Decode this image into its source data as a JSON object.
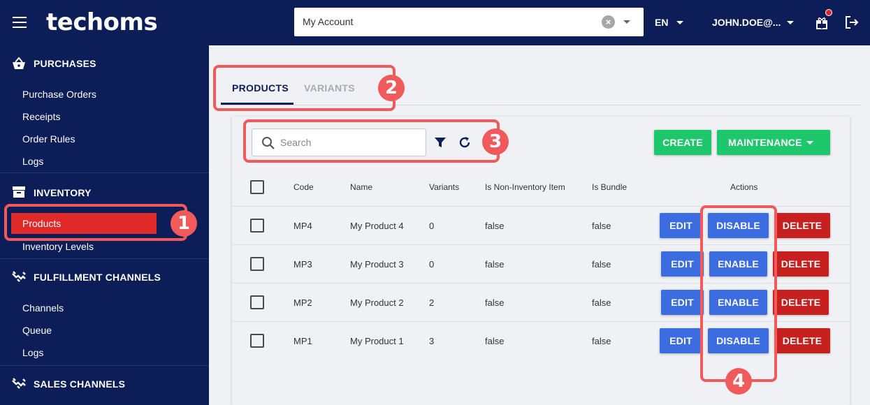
{
  "header": {
    "logo": "techoms",
    "account_value": "My Account",
    "language": "EN",
    "user": "JOHN.DOE@..."
  },
  "sidebar": {
    "sections": [
      {
        "title": "PURCHASES",
        "items": [
          "Purchase Orders",
          "Receipts",
          "Order Rules",
          "Logs"
        ]
      },
      {
        "title": "INVENTORY",
        "items": [
          "Products",
          "Inventory Levels"
        ]
      },
      {
        "title": "FULFILLMENT CHANNELS",
        "items": [
          "Channels",
          "Queue",
          "Logs"
        ]
      },
      {
        "title": "SALES CHANNELS",
        "items": []
      }
    ],
    "active_item": "Products"
  },
  "tabs": [
    {
      "label": "PRODUCTS",
      "active": true
    },
    {
      "label": "VARIANTS",
      "active": false
    }
  ],
  "toolbar": {
    "search_placeholder": "Search",
    "create_label": "CREATE",
    "maintenance_label": "MAINTENANCE"
  },
  "table": {
    "headers": [
      "Code",
      "Name",
      "Variants",
      "Is Non-Inventory Item",
      "Is Bundle",
      "Actions"
    ],
    "rows": [
      {
        "code": "MP4",
        "name": "My Product 4",
        "variants": "0",
        "non_inventory": "false",
        "bundle": "false",
        "edit": "EDIT",
        "toggle": "DISABLE",
        "delete": "DELETE"
      },
      {
        "code": "MP3",
        "name": "My Product 3",
        "variants": "0",
        "non_inventory": "false",
        "bundle": "false",
        "edit": "EDIT",
        "toggle": "ENABLE",
        "delete": "DELETE"
      },
      {
        "code": "MP2",
        "name": "My Product 2",
        "variants": "2",
        "non_inventory": "false",
        "bundle": "false",
        "edit": "EDIT",
        "toggle": "ENABLE",
        "delete": "DELETE"
      },
      {
        "code": "MP1",
        "name": "My Product 1",
        "variants": "3",
        "non_inventory": "false",
        "bundle": "false",
        "edit": "EDIT",
        "toggle": "DISABLE",
        "delete": "DELETE"
      }
    ]
  },
  "annotations": [
    "1",
    "2",
    "3",
    "4"
  ],
  "colors": {
    "navy": "#0c1d57",
    "accent_red": "#e02a2a",
    "green": "#1ec66c",
    "blue": "#3b6de0",
    "delete_red": "#c6201f",
    "annotation": "#f05a5a"
  }
}
